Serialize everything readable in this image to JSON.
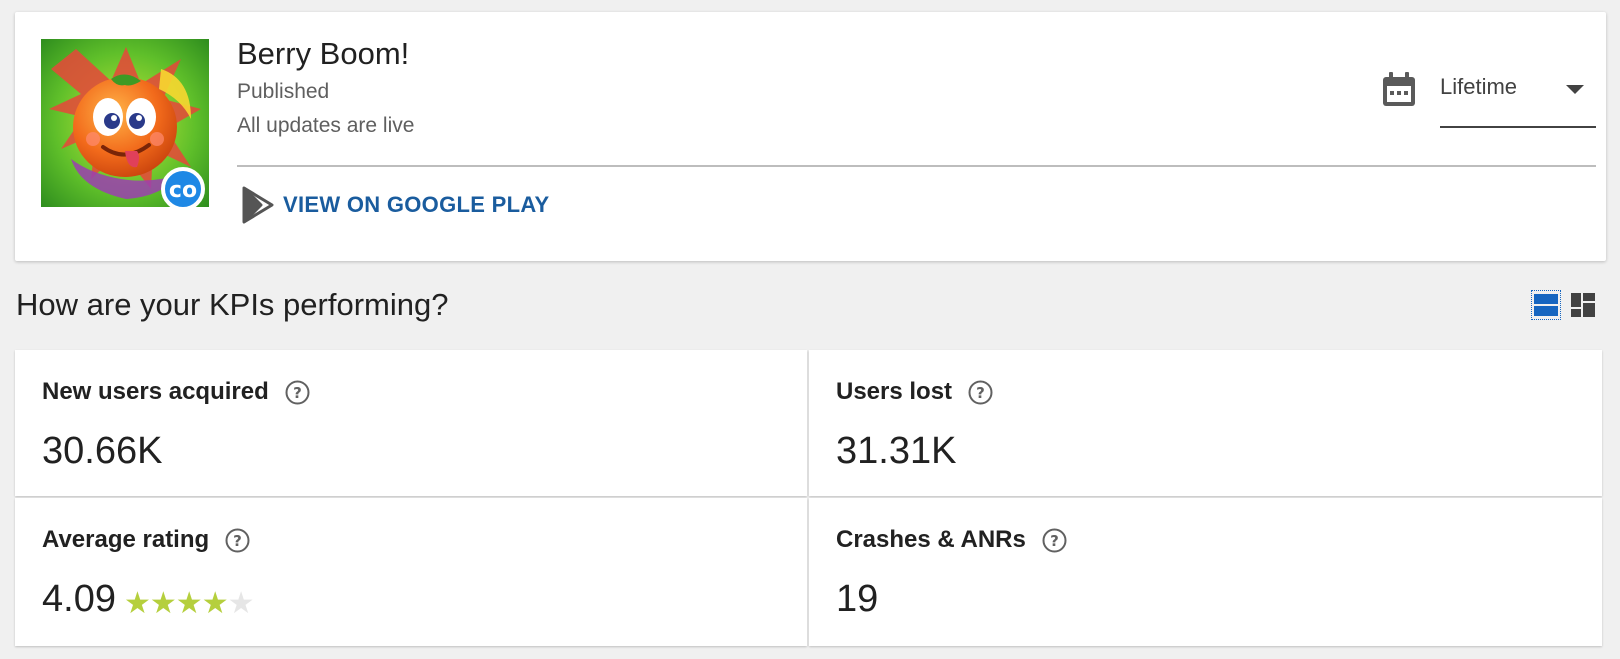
{
  "app": {
    "name": "Berry Boom!",
    "status": "Published",
    "update_status": "All updates are live",
    "play_link_label": "VIEW ON GOOGLE PLAY",
    "icon": "berry-boom-app-icon"
  },
  "date_range": {
    "selected": "Lifetime",
    "icon": "calendar-icon"
  },
  "kpi_section": {
    "title": "How are your KPIs performing?",
    "view_modes": [
      "list-view",
      "dashboard-view"
    ],
    "active_view": "list-view"
  },
  "kpis": [
    {
      "label": "New users acquired",
      "value": "30.66K"
    },
    {
      "label": "Users lost",
      "value": "31.31K"
    },
    {
      "label": "Average rating",
      "value": "4.09",
      "rating": 4.09,
      "max_rating": 5
    },
    {
      "label": "Crashes & ANRs",
      "value": "19"
    }
  ],
  "colors": {
    "link": "#1a5c9e",
    "star_filled": "#b5cf3d",
    "star_empty": "#e6e6e6",
    "view_active": "#1565c0"
  }
}
